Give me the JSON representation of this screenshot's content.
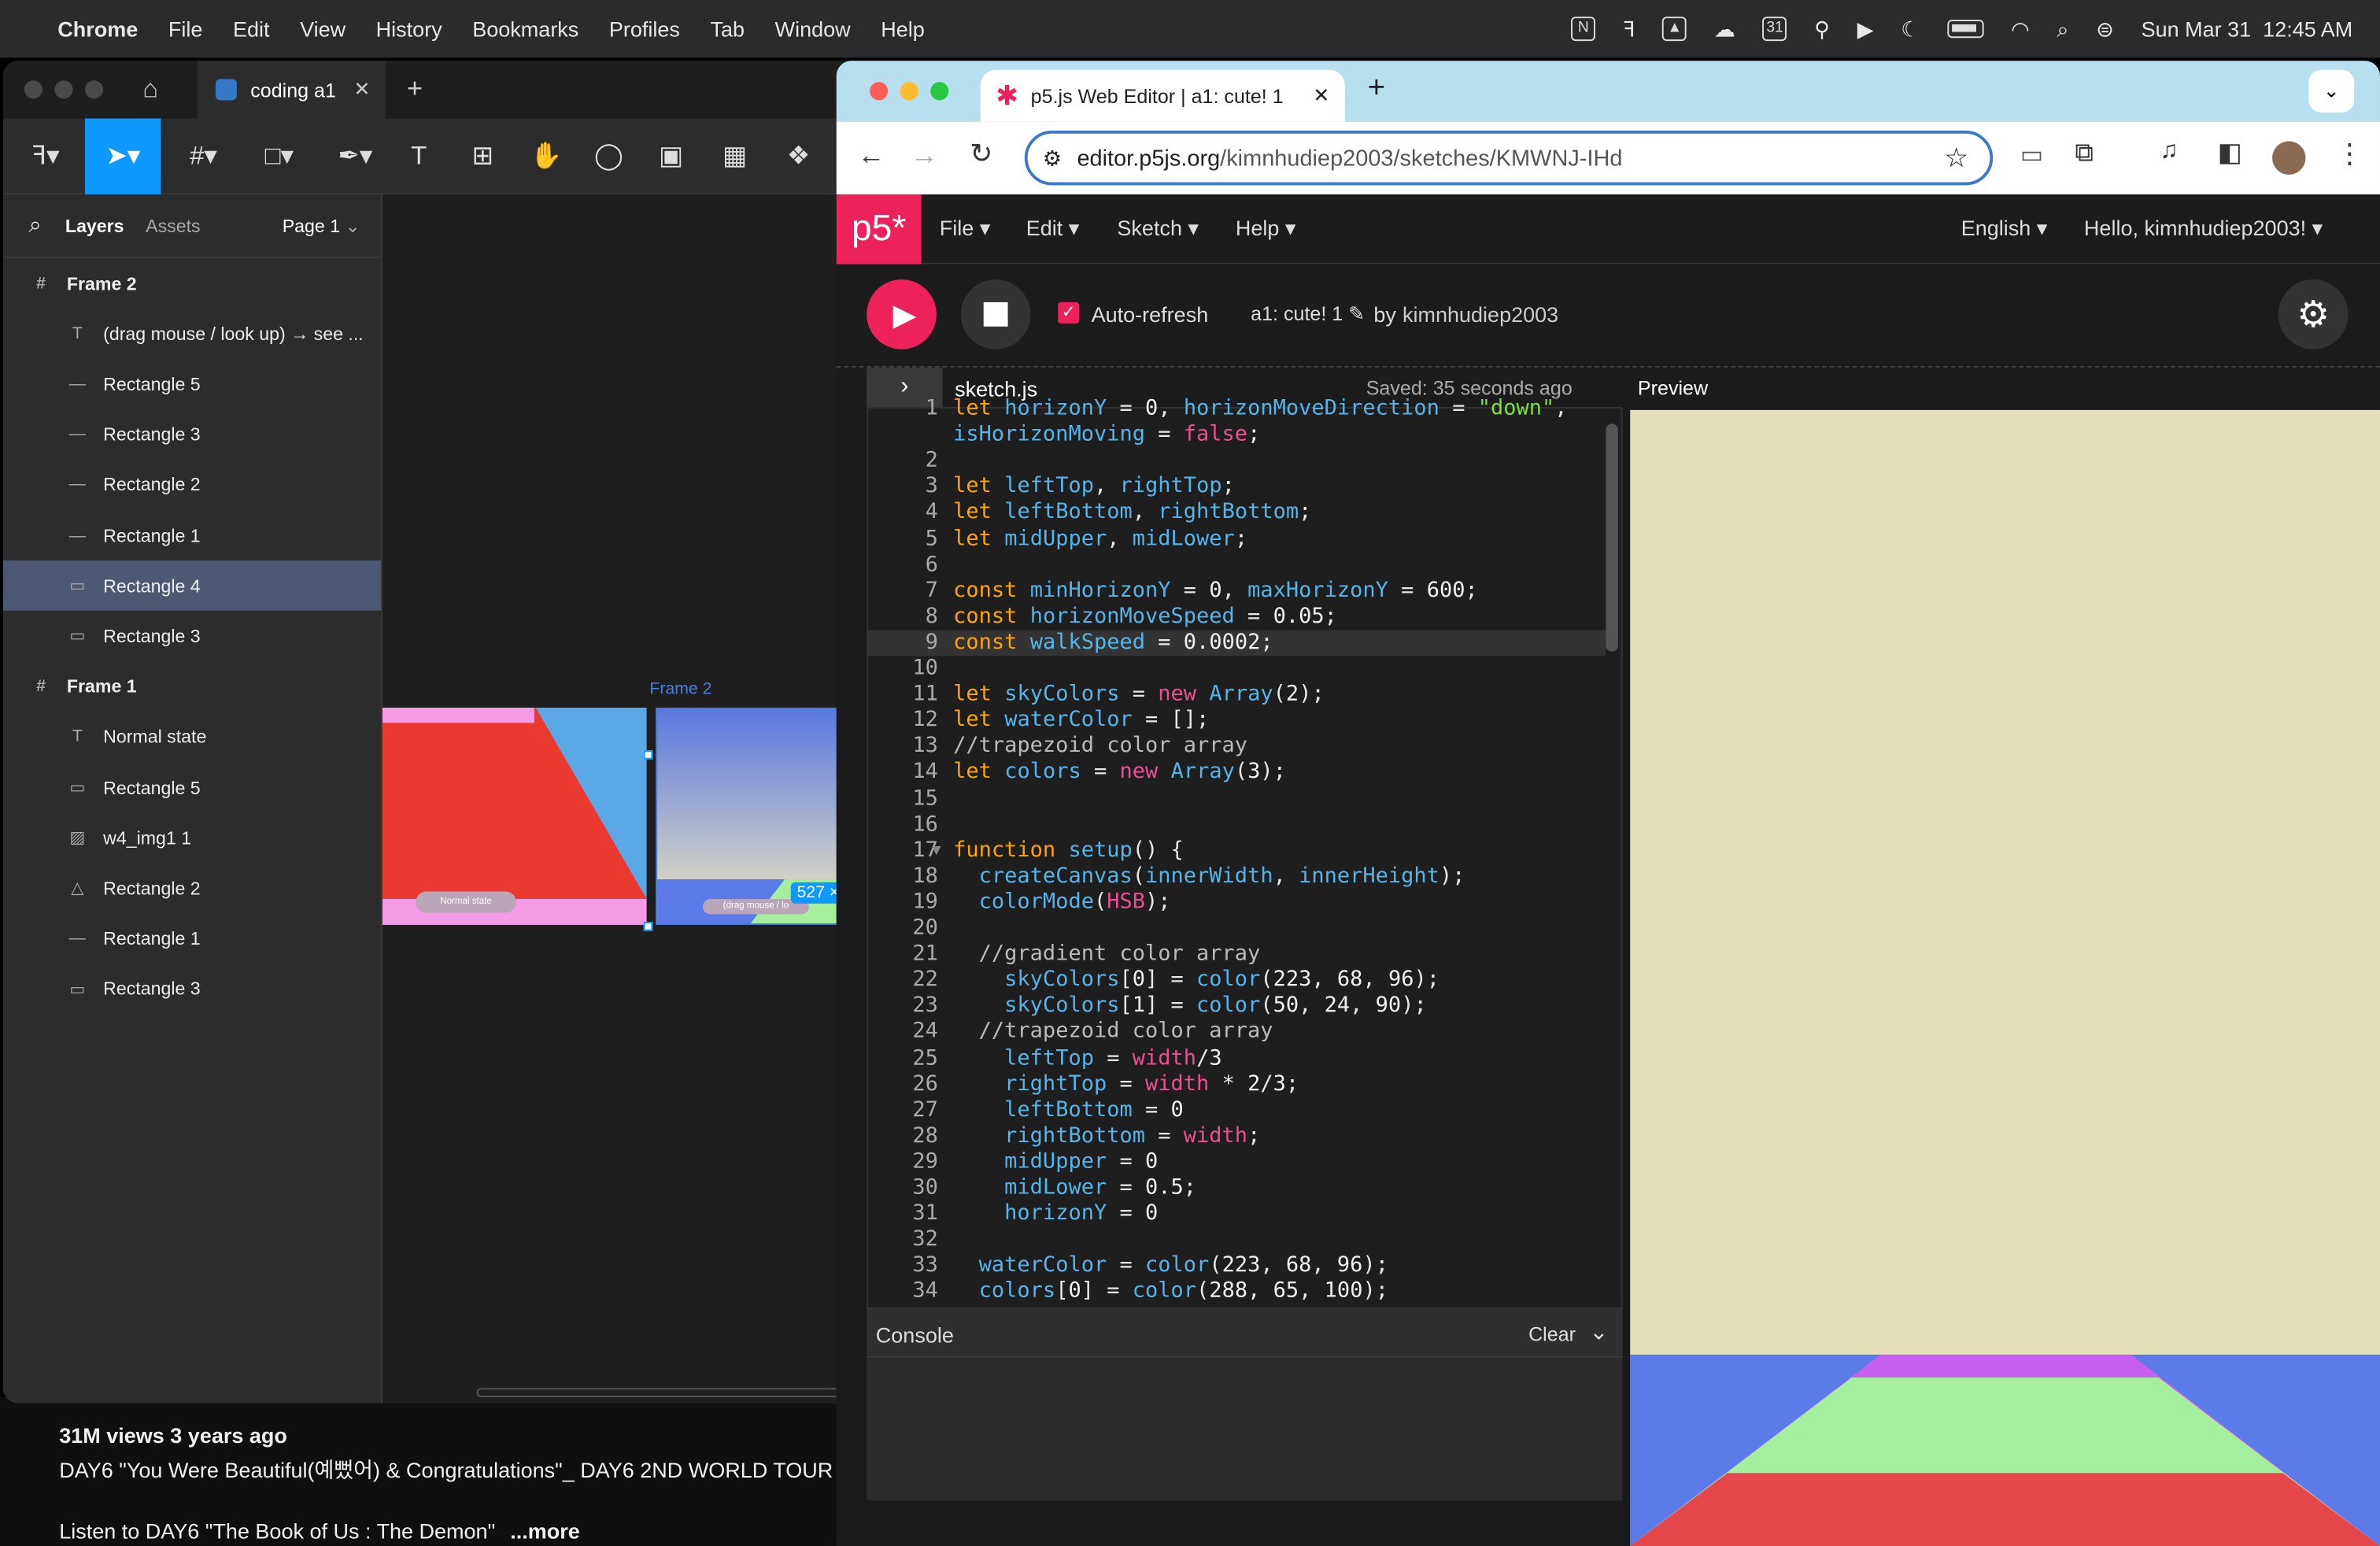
{
  "menubar": {
    "app": "Chrome",
    "items": [
      "File",
      "Edit",
      "View",
      "History",
      "Bookmarks",
      "Profiles",
      "Tab",
      "Window",
      "Help"
    ],
    "datetime": "Sun Mar 31  12:45 AM"
  },
  "youtube": {
    "views": "31M views  3 years ago",
    "title": "DAY6 \"You Were Beautiful(예뻤어) & Congratulations\"_ DAY6 2ND WORLD TOUR '",
    "desc": "Listen to DAY6 \"The Book of Us : The Demon\"",
    "more": "...more"
  },
  "figma": {
    "tab": "coding a1",
    "panel": {
      "layers_tab": "Layers",
      "assets_tab": "Assets",
      "page": "Page 1"
    },
    "layers": [
      {
        "label": "Frame 2",
        "icon": "#",
        "frame": true
      },
      {
        "label": "(drag mouse / look up) → see ...",
        "icon": "T"
      },
      {
        "label": "Rectangle 5",
        "icon": "—"
      },
      {
        "label": "Rectangle 3",
        "icon": "—"
      },
      {
        "label": "Rectangle 2",
        "icon": "—"
      },
      {
        "label": "Rectangle 1",
        "icon": "—"
      },
      {
        "label": "Rectangle 4",
        "icon": "▭",
        "selected": true
      },
      {
        "label": "Rectangle 3",
        "icon": "▭"
      },
      {
        "label": "Frame 1",
        "icon": "#",
        "frame": true
      },
      {
        "label": "Normal state",
        "icon": "T"
      },
      {
        "label": "Rectangle 5",
        "icon": "▭"
      },
      {
        "label": "w4_img1 1",
        "icon": "▨"
      },
      {
        "label": "Rectangle 2",
        "icon": "△"
      },
      {
        "label": "Rectangle 1",
        "icon": "—"
      },
      {
        "label": "Rectangle 3",
        "icon": "▭"
      }
    ],
    "canvas": {
      "frame_label": "Frame 2",
      "normal_label": "Normal state",
      "drag_label": "(drag mouse / lo",
      "size_badge": "527 ×"
    }
  },
  "chrome": {
    "tab_title": "p5.js Web Editor | a1: cute! 1",
    "url_host": "editor.p5js.org",
    "url_path": "/kimnhudiep2003/sketches/KMWNJ-IHd"
  },
  "p5": {
    "logo": "p5*",
    "menu": [
      "File ▾",
      "Edit ▾",
      "Sketch ▾",
      "Help ▾"
    ],
    "language": "English ▾",
    "user": "Hello, kimnhudiep2003! ▾",
    "autorefresh": "Auto-refresh",
    "sketch_name": "a1: cute! 1 ✎",
    "by": "by",
    "author": "kimnhudiep2003",
    "file": "sketch.js",
    "saved": "Saved: 35 seconds ago",
    "preview": "Preview",
    "console": "Console",
    "clear": "Clear"
  },
  "code": [
    {
      "n": "1",
      "html": "<span class='kw'>let</span> <span class='vr'>horizonY</span> = <span class='nu'>0</span>, <span class='vr'>horizonMoveDirection</span> = <span class='st'>\"down\"</span>,"
    },
    {
      "n": "",
      "html": "<span class='vr'>isHorizonMoving</span> = <span class='fn'>false</span>;"
    },
    {
      "n": "2",
      "html": ""
    },
    {
      "n": "3",
      "html": "<span class='kw'>let</span> <span class='vr'>leftTop</span>, <span class='vr'>rightTop</span>;"
    },
    {
      "n": "4",
      "html": "<span class='kw'>let</span> <span class='vr'>leftBottom</span>, <span class='vr'>rightBottom</span>;"
    },
    {
      "n": "5",
      "html": "<span class='kw'>let</span> <span class='vr'>midUpper</span>, <span class='vr'>midLower</span>;"
    },
    {
      "n": "6",
      "html": ""
    },
    {
      "n": "7",
      "html": "<span class='kw'>const</span> <span class='vr'>minHorizonY</span> = <span class='nu'>0</span>, <span class='vr'>maxHorizonY</span> = <span class='nu'>600</span>;"
    },
    {
      "n": "8",
      "html": "<span class='kw'>const</span> <span class='vr'>horizonMoveSpeed</span> = <span class='nu'>0.05</span>;"
    },
    {
      "n": "9",
      "html": "<span class='kw'>const</span> <span class='vr'>walkSpeed</span> = <span class='nu'>0.0002</span>;",
      "hl": true
    },
    {
      "n": "10",
      "html": ""
    },
    {
      "n": "11",
      "html": "<span class='kw'>let</span> <span class='vr'>skyColors</span> = <span class='fn'>new</span> <span class='vr'>Array</span>(<span class='nu'>2</span>);"
    },
    {
      "n": "12",
      "html": "<span class='kw'>let</span> <span class='vr'>waterColor</span> = [];"
    },
    {
      "n": "13",
      "html": "<span class='cm'>//trapezoid color array</span>"
    },
    {
      "n": "14",
      "html": "<span class='kw'>let</span> <span class='vr'>colors</span> = <span class='fn'>new</span> <span class='vr'>Array</span>(<span class='nu'>3</span>);"
    },
    {
      "n": "15",
      "html": ""
    },
    {
      "n": "16",
      "html": ""
    },
    {
      "n": "17",
      "html": "<span class='kw'>function</span> <span class='vr'>setup</span>() {"
    },
    {
      "n": "18",
      "html": "  <span class='vr'>createCanvas</span>(<span class='vr'>innerWidth</span>, <span class='vr'>innerHeight</span>);"
    },
    {
      "n": "19",
      "html": "  <span class='vr'>colorMode</span>(<span class='fn'>HSB</span>);"
    },
    {
      "n": "20",
      "html": ""
    },
    {
      "n": "21",
      "html": "  <span class='cm'>//gradient color array</span>"
    },
    {
      "n": "22",
      "html": "    <span class='vr'>skyColors</span>[<span class='nu'>0</span>] = <span class='vr'>color</span>(<span class='nu'>223</span>, <span class='nu'>68</span>, <span class='nu'>96</span>);"
    },
    {
      "n": "23",
      "html": "    <span class='vr'>skyColors</span>[<span class='nu'>1</span>] = <span class='vr'>color</span>(<span class='nu'>50</span>, <span class='nu'>24</span>, <span class='nu'>90</span>);"
    },
    {
      "n": "24",
      "html": "  <span class='cm'>//trapezoid color array</span>"
    },
    {
      "n": "25",
      "html": "    <span class='vr'>leftTop</span> = <span class='fn'>width</span>/<span class='nu'>3</span>"
    },
    {
      "n": "26",
      "html": "    <span class='vr'>rightTop</span> = <span class='fn'>width</span> * <span class='nu'>2</span>/<span class='nu'>3</span>;"
    },
    {
      "n": "27",
      "html": "    <span class='vr'>leftBottom</span> = <span class='nu'>0</span>"
    },
    {
      "n": "28",
      "html": "    <span class='vr'>rightBottom</span> = <span class='fn'>width</span>;"
    },
    {
      "n": "29",
      "html": "    <span class='vr'>midUpper</span> = <span class='nu'>0</span>"
    },
    {
      "n": "30",
      "html": "    <span class='vr'>midLower</span> = <span class='nu'>0.5</span>;"
    },
    {
      "n": "31",
      "html": "    <span class='vr'>horizonY</span> = <span class='nu'>0</span>"
    },
    {
      "n": "32",
      "html": ""
    },
    {
      "n": "33",
      "html": "  <span class='vr'>waterColor</span> = <span class='vr'>color</span>(<span class='nu'>223</span>, <span class='nu'>68</span>, <span class='nu'>96</span>);"
    },
    {
      "n": "34",
      "html": "  <span class='vr'>colors</span>[<span class='nu'>0</span>] = <span class='vr'>color</span>(<span class='nu'>288</span>, <span class='nu'>65</span>, <span class='nu'>100</span>);"
    }
  ],
  "colors": {
    "p5_pink": "#ed225d",
    "preview_bg": "#e3dfb8",
    "preview_blue": "#5a7be8",
    "stripe_purple": "#c85ef0",
    "stripe_green": "#a4ee9e",
    "stripe_red": "#e5474b"
  }
}
